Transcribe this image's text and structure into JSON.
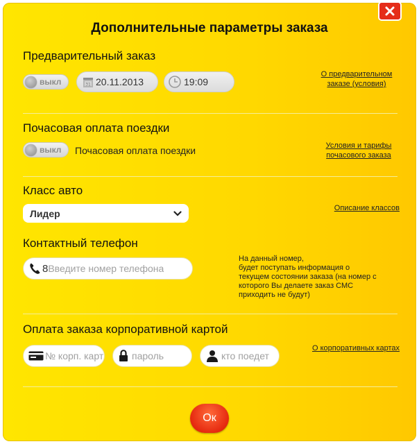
{
  "dialog": {
    "title": "Дополнительные параметры заказа",
    "close_symbol": "✕"
  },
  "preorder": {
    "title": "Предварительный заказ",
    "toggle_label": "выкл",
    "date": "20.11.2013",
    "time": "19:09",
    "link_line1": "О предварительном",
    "link_line2": "заказе (условия)"
  },
  "hourly": {
    "title": "Почасовая оплата поездки",
    "toggle_label": "выкл",
    "label": "Почасовая оплата поездки",
    "link_line1": "Условия и тарифы",
    "link_line2": "почасового заказа"
  },
  "car_class": {
    "title": "Класс авто",
    "selected": "Лидер",
    "link": "Описание классов"
  },
  "phone": {
    "title": "Контактный телефон",
    "prefix": "8",
    "placeholder": "Введите номер телефона",
    "info_lines": [
      "На данный номер,",
      "будет поступать информация о",
      "текущем состоянии заказа (на номер с",
      "которого Вы делаете заказ СМС",
      "приходить не будут)"
    ]
  },
  "corporate": {
    "title": "Оплата заказа корпоративной картой",
    "card_placeholder": "№ корп. карт",
    "password_placeholder": "пароль",
    "passenger_placeholder": "кто поедет",
    "link": "О корпоративных картах"
  },
  "ok_label": "Ок",
  "colors": {
    "background": "#ffdc00",
    "close": "#e52d1a",
    "ok": "#e62a10"
  },
  "icons": [
    "close-icon",
    "calendar-icon",
    "clock-icon",
    "chevron-down-icon",
    "phone-icon",
    "card-icon",
    "lock-icon",
    "person-icon"
  ]
}
